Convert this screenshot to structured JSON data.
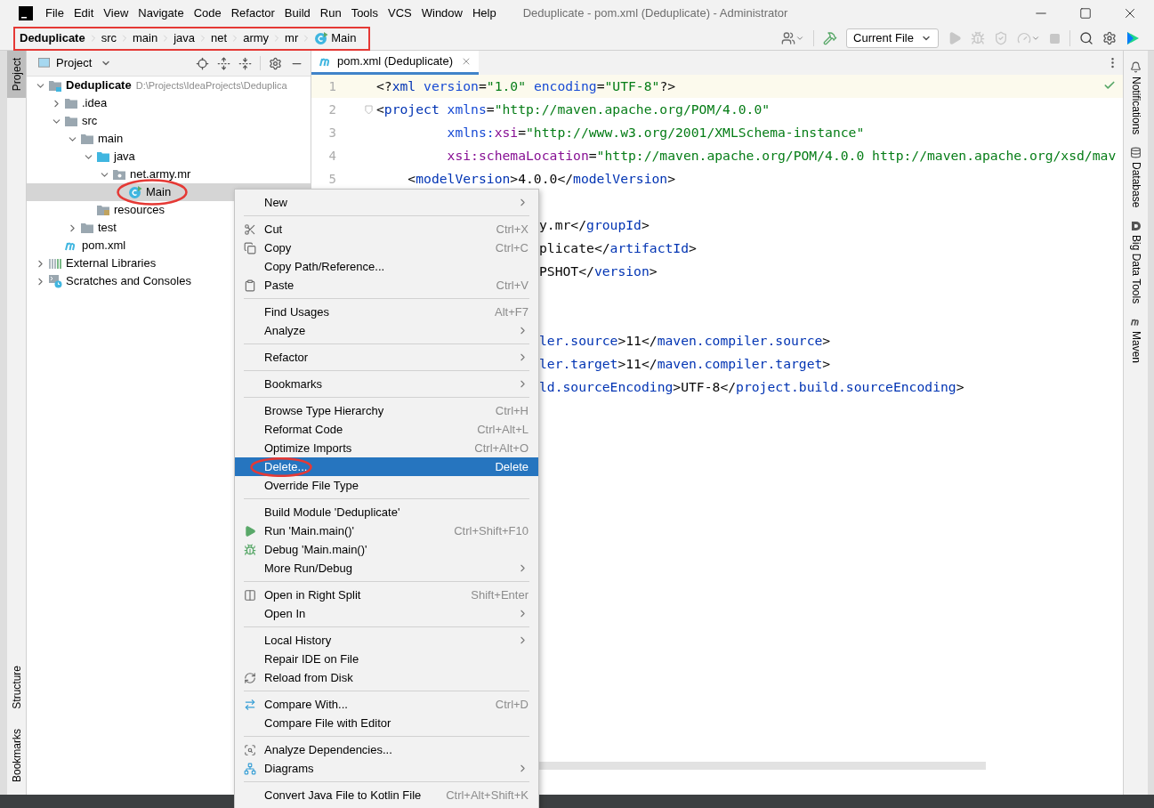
{
  "window": {
    "title": "Deduplicate - pom.xml (Deduplicate) - Administrator"
  },
  "menu_bar": [
    "File",
    "Edit",
    "View",
    "Navigate",
    "Code",
    "Refactor",
    "Build",
    "Run",
    "Tools",
    "VCS",
    "Window",
    "Help"
  ],
  "breadcrumbs": [
    {
      "label": "Deduplicate",
      "kind": "project"
    },
    {
      "label": "src",
      "kind": "dir"
    },
    {
      "label": "main",
      "kind": "dir"
    },
    {
      "label": "java",
      "kind": "dir"
    },
    {
      "label": "net",
      "kind": "dir"
    },
    {
      "label": "army",
      "kind": "dir"
    },
    {
      "label": "mr",
      "kind": "dir"
    },
    {
      "label": "Main",
      "kind": "class"
    }
  ],
  "toolbar": {
    "run_config": "Current File"
  },
  "left_stripe": {
    "top": [
      {
        "label": "Project",
        "selected": true
      }
    ],
    "bottom": [
      {
        "label": "Structure",
        "selected": false
      },
      {
        "label": "Bookmarks",
        "selected": false
      }
    ]
  },
  "project_panel": {
    "title": "Project",
    "tree": [
      {
        "label": "Deduplicate",
        "path": "D:\\Projects\\IdeaProjects\\Deduplica",
        "kind": "module",
        "expanded": true,
        "selected": false,
        "children": [
          {
            "label": ".idea",
            "kind": "folder",
            "expanded": false,
            "selected": false
          },
          {
            "label": "src",
            "kind": "folder",
            "expanded": true,
            "selected": false,
            "children": [
              {
                "label": "main",
                "kind": "folder",
                "expanded": true,
                "selected": false,
                "children": [
                  {
                    "label": "java",
                    "kind": "source-folder",
                    "expanded": true,
                    "selected": false,
                    "children": [
                      {
                        "label": "net.army.mr",
                        "kind": "package",
                        "expanded": true,
                        "selected": false,
                        "children": [
                          {
                            "label": "Main",
                            "kind": "class",
                            "selected": true
                          }
                        ]
                      }
                    ]
                  },
                  {
                    "label": "resources",
                    "kind": "resources-folder",
                    "selected": false
                  }
                ]
              },
              {
                "label": "test",
                "kind": "folder",
                "expanded": false,
                "selected": false
              }
            ]
          },
          {
            "label": "pom.xml",
            "kind": "maven",
            "selected": false
          }
        ]
      },
      {
        "label": "External Libraries",
        "kind": "libraries",
        "expanded": false,
        "selected": false
      },
      {
        "label": "Scratches and Consoles",
        "kind": "scratches",
        "expanded": false,
        "selected": false
      }
    ]
  },
  "editor": {
    "tabs": [
      {
        "label": "pom.xml (Deduplicate)",
        "selected": true
      }
    ],
    "lines": [
      {
        "kind": "code",
        "number": "1",
        "current": true,
        "segments": [
          {
            "kind": "text",
            "text": "<?"
          },
          {
            "kind": "tag",
            "text": "xml "
          },
          {
            "kind": "attr",
            "text": "version"
          },
          {
            "kind": "text",
            "text": "="
          },
          {
            "kind": "value",
            "text": "\"1.0\" "
          },
          {
            "kind": "attr",
            "text": "encoding"
          },
          {
            "kind": "text",
            "text": "="
          },
          {
            "kind": "value",
            "text": "\"UTF-8\""
          },
          {
            "kind": "text",
            "text": "?>"
          }
        ]
      },
      {
        "kind": "code",
        "number": "2",
        "current": false,
        "segments": [
          {
            "kind": "text",
            "text": "<"
          },
          {
            "kind": "tag",
            "text": "project "
          },
          {
            "kind": "attr",
            "text": "xmlns"
          },
          {
            "kind": "text",
            "text": "="
          },
          {
            "kind": "value",
            "text": "\"http://maven.apache.org/POM/4.0.0\""
          }
        ]
      },
      {
        "kind": "code",
        "number": "3",
        "current": false,
        "segments": [
          {
            "kind": "attr",
            "text": "         xmlns:"
          },
          {
            "kind": "ns",
            "text": "xsi"
          },
          {
            "kind": "text",
            "text": "="
          },
          {
            "kind": "value",
            "text": "\"http://www.w3.org/2001/XMLSchema-instance\""
          }
        ]
      },
      {
        "kind": "code",
        "number": "4",
        "current": false,
        "segments": [
          {
            "kind": "ns",
            "text": "         xsi:schemaLocation"
          },
          {
            "kind": "text",
            "text": "="
          },
          {
            "kind": "value",
            "text": "\"http://maven.apache.org/POM/4.0.0 http://maven.apache.org/xsd/mav"
          }
        ]
      },
      {
        "kind": "code",
        "number": "5",
        "current": false,
        "segments": [
          {
            "kind": "text",
            "text": "    <"
          },
          {
            "kind": "tag",
            "text": "modelVersion"
          },
          {
            "kind": "text",
            "text": ">4.0.0</"
          },
          {
            "kind": "tag",
            "text": "modelVersion"
          },
          {
            "kind": "text",
            "text": ">"
          }
        ]
      },
      {
        "kind": "blank"
      },
      {
        "kind": "covered",
        "segments": [
          {
            "kind": "text",
            "text": "y.mr</"
          },
          {
            "kind": "tag",
            "text": "groupId"
          },
          {
            "kind": "text",
            "text": ">"
          }
        ]
      },
      {
        "kind": "covered",
        "segments": [
          {
            "kind": "text",
            "text": "plicate</"
          },
          {
            "kind": "tag",
            "text": "artifactId"
          },
          {
            "kind": "text",
            "text": ">"
          }
        ]
      },
      {
        "kind": "covered",
        "segments": [
          {
            "kind": "text",
            "text": "PSHOT</"
          },
          {
            "kind": "tag",
            "text": "version"
          },
          {
            "kind": "text",
            "text": ">"
          }
        ]
      },
      {
        "kind": "blank"
      },
      {
        "kind": "blank"
      },
      {
        "kind": "covered",
        "segments": [
          {
            "kind": "tag",
            "text": "ler.source"
          },
          {
            "kind": "text",
            "text": ">11</"
          },
          {
            "kind": "tag",
            "text": "maven.compiler.source"
          },
          {
            "kind": "text",
            "text": ">"
          }
        ]
      },
      {
        "kind": "covered",
        "segments": [
          {
            "kind": "tag",
            "text": "ler.target"
          },
          {
            "kind": "text",
            "text": ">11</"
          },
          {
            "kind": "tag",
            "text": "maven.compiler.target"
          },
          {
            "kind": "text",
            "text": ">"
          }
        ]
      },
      {
        "kind": "covered",
        "segments": [
          {
            "kind": "tag",
            "text": "ld.sourceEncoding"
          },
          {
            "kind": "text",
            "text": ">UTF-8</"
          },
          {
            "kind": "tag",
            "text": "project.build.sourceEncoding"
          },
          {
            "kind": "text",
            "text": ">"
          }
        ]
      }
    ]
  },
  "right_stripe": [
    "Notifications",
    "Database",
    "Big Data Tools",
    "Maven"
  ],
  "context_menu": {
    "groups": [
      [
        {
          "label": "New",
          "submenu": true,
          "selected": false
        }
      ],
      [
        {
          "label": "Cut",
          "shortcut": "Ctrl+X",
          "selected": false
        },
        {
          "label": "Copy",
          "shortcut": "Ctrl+C",
          "selected": false
        },
        {
          "label": "Copy Path/Reference...",
          "selected": false
        },
        {
          "label": "Paste",
          "shortcut": "Ctrl+V",
          "selected": false
        }
      ],
      [
        {
          "label": "Find Usages",
          "shortcut": "Alt+F7",
          "selected": false
        },
        {
          "label": "Analyze",
          "submenu": true,
          "selected": false
        }
      ],
      [
        {
          "label": "Refactor",
          "submenu": true,
          "selected": false
        }
      ],
      [
        {
          "label": "Bookmarks",
          "submenu": true,
          "selected": false
        }
      ],
      [
        {
          "label": "Browse Type Hierarchy",
          "shortcut": "Ctrl+H",
          "selected": false
        },
        {
          "label": "Reformat Code",
          "shortcut": "Ctrl+Alt+L",
          "selected": false
        },
        {
          "label": "Optimize Imports",
          "shortcut": "Ctrl+Alt+O",
          "selected": false
        },
        {
          "label": "Delete...",
          "shortcut": "Delete",
          "selected": true
        },
        {
          "label": "Override File Type",
          "selected": false
        }
      ],
      [
        {
          "label": "Build Module 'Deduplicate'",
          "selected": false
        },
        {
          "label": "Run 'Main.main()'",
          "shortcut": "Ctrl+Shift+F10",
          "selected": false
        },
        {
          "label": "Debug 'Main.main()'",
          "selected": false
        },
        {
          "label": "More Run/Debug",
          "submenu": true,
          "selected": false
        }
      ],
      [
        {
          "label": "Open in Right Split",
          "shortcut": "Shift+Enter",
          "selected": false
        },
        {
          "label": "Open In",
          "submenu": true,
          "selected": false
        }
      ],
      [
        {
          "label": "Local History",
          "submenu": true,
          "selected": false
        },
        {
          "label": "Repair IDE on File",
          "selected": false
        },
        {
          "label": "Reload from Disk",
          "selected": false
        }
      ],
      [
        {
          "label": "Compare With...",
          "shortcut": "Ctrl+D",
          "selected": false
        },
        {
          "label": "Compare File with Editor",
          "selected": false
        }
      ],
      [
        {
          "label": "Analyze Dependencies...",
          "selected": false
        },
        {
          "label": "Diagrams",
          "submenu": true,
          "selected": false
        }
      ],
      [
        {
          "label": "Convert Java File to Kotlin File",
          "shortcut": "Ctrl+Alt+Shift+K",
          "selected": false
        }
      ]
    ]
  }
}
